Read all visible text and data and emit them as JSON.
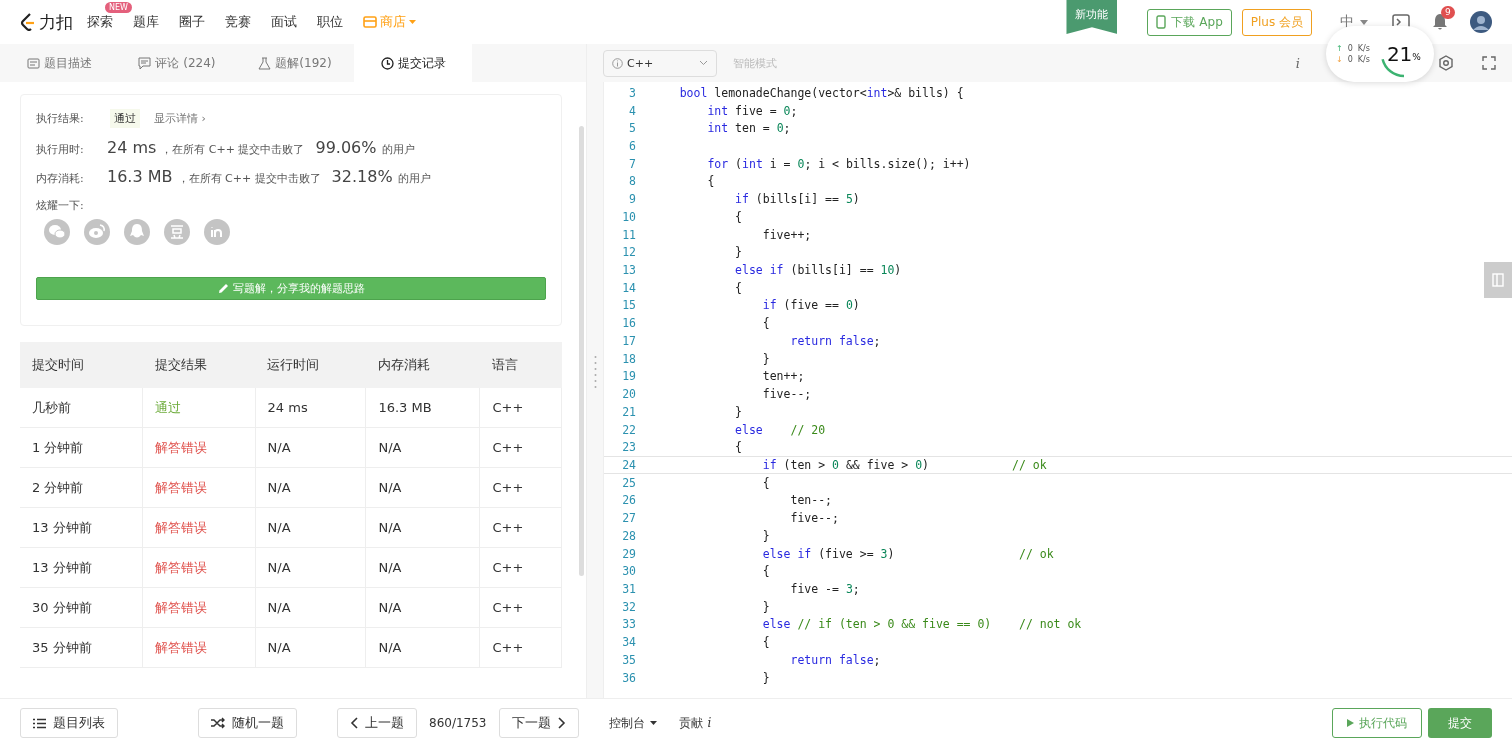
{
  "nav": {
    "brand": "力扣",
    "items": [
      {
        "label": "探索",
        "badge": "NEW",
        "kind": "plain"
      },
      {
        "label": "题库",
        "kind": "plain"
      },
      {
        "label": "圈子",
        "kind": "plain"
      },
      {
        "label": "竞赛",
        "kind": "plain"
      },
      {
        "label": "面试",
        "kind": "plain"
      },
      {
        "label": "职位",
        "kind": "plain"
      },
      {
        "label": "商店",
        "kind": "store"
      }
    ],
    "new_feature": "新功能",
    "download": "下载 App",
    "plus": "Plus 会员",
    "lang": "中",
    "notifications": "9"
  },
  "monitor": {
    "up_arrow": "↑",
    "up": "0",
    "up_unit": "K/s",
    "down_arrow": "↓",
    "down": "0",
    "down_unit": "K/s",
    "percent": "21",
    "percent_sign": "%",
    "level": 0.21
  },
  "tabs": [
    {
      "label": "题目描述",
      "selected": false
    },
    {
      "label": "评论 (224)",
      "selected": false
    },
    {
      "label": "题解(192)",
      "selected": false
    },
    {
      "label": "提交记录",
      "selected": true
    }
  ],
  "result": {
    "label": "执行结果:",
    "status": "通过",
    "details": "显示详情 ›",
    "stats": [
      {
        "label": "执行用时:",
        "value": "24 ms",
        "text": "，在所有 C++ 提交中击败了",
        "percent": "99.06%",
        "suffix": "的用户"
      },
      {
        "label": "内存消耗:",
        "value": "16.3 MB",
        "text": "，在所有 C++ 提交中击败了",
        "percent": "32.18%",
        "suffix": "的用户"
      }
    ],
    "share_label": "炫耀一下:",
    "share": [
      {
        "kind": "wechat"
      },
      {
        "kind": "weibo"
      },
      {
        "kind": "qq"
      },
      {
        "kind": "douban"
      },
      {
        "kind": "linkedin"
      }
    ],
    "write_button": "写题解，分享我的解题思路"
  },
  "table": {
    "columns": [
      "提交时间",
      "提交结果",
      "运行时间",
      "内存消耗",
      "语言"
    ],
    "rows": [
      {
        "time": "几秒前",
        "result": "通过",
        "kind": "pass",
        "runtime": "24 ms",
        "memory": "16.3 MB",
        "lang": "C++"
      },
      {
        "time": "1 分钟前",
        "result": "解答错误",
        "kind": "fail",
        "runtime": "N/A",
        "memory": "N/A",
        "lang": "C++"
      },
      {
        "time": "2 分钟前",
        "result": "解答错误",
        "kind": "fail",
        "runtime": "N/A",
        "memory": "N/A",
        "lang": "C++"
      },
      {
        "time": "13 分钟前",
        "result": "解答错误",
        "kind": "fail",
        "runtime": "N/A",
        "memory": "N/A",
        "lang": "C++"
      },
      {
        "time": "13 分钟前",
        "result": "解答错误",
        "kind": "fail",
        "runtime": "N/A",
        "memory": "N/A",
        "lang": "C++"
      },
      {
        "time": "30 分钟前",
        "result": "解答错误",
        "kind": "fail",
        "runtime": "N/A",
        "memory": "N/A",
        "lang": "C++"
      },
      {
        "time": "35 分钟前",
        "result": "解答错误",
        "kind": "fail",
        "runtime": "N/A",
        "memory": "N/A",
        "lang": "C++"
      }
    ]
  },
  "editor": {
    "language": "C++",
    "smart_mode": "智能模式",
    "info": "i",
    "lines": [
      {
        "n": "3",
        "current": false,
        "parts": [
          {
            "kind": "kw",
            "t": "    bool"
          },
          {
            "kind": "plain",
            "t": " lemonadeChange(vector<"
          },
          {
            "kind": "kw",
            "t": "int"
          },
          {
            "kind": "plain",
            "t": ">& bills) {"
          }
        ]
      },
      {
        "n": "4",
        "current": false,
        "parts": [
          {
            "kind": "kw",
            "t": "        int"
          },
          {
            "kind": "plain",
            "t": " five = "
          },
          {
            "kind": "num",
            "t": "0"
          },
          {
            "kind": "plain",
            "t": ";"
          }
        ]
      },
      {
        "n": "5",
        "current": false,
        "parts": [
          {
            "kind": "kw",
            "t": "        int"
          },
          {
            "kind": "plain",
            "t": " ten = "
          },
          {
            "kind": "num",
            "t": "0"
          },
          {
            "kind": "plain",
            "t": ";"
          }
        ]
      },
      {
        "n": "6",
        "current": false
      },
      {
        "n": "7",
        "current": false,
        "parts": [
          {
            "kind": "kw",
            "t": "        for"
          },
          {
            "kind": "plain",
            "t": " ("
          },
          {
            "kind": "kw",
            "t": "int"
          },
          {
            "kind": "plain",
            "t": " i = "
          },
          {
            "kind": "num",
            "t": "0"
          },
          {
            "kind": "plain",
            "t": "; i < bills.size(); i++)"
          }
        ]
      },
      {
        "n": "8",
        "current": false,
        "parts": [
          {
            "kind": "plain",
            "t": "        {"
          }
        ]
      },
      {
        "n": "9",
        "current": false,
        "parts": [
          {
            "kind": "kw",
            "t": "            if"
          },
          {
            "kind": "plain",
            "t": " (bills[i] == "
          },
          {
            "kind": "num",
            "t": "5"
          },
          {
            "kind": "plain",
            "t": ")"
          }
        ]
      },
      {
        "n": "10",
        "current": false,
        "parts": [
          {
            "kind": "plain",
            "t": "            {"
          }
        ]
      },
      {
        "n": "11",
        "current": false,
        "parts": [
          {
            "kind": "plain",
            "t": "                five++;"
          }
        ]
      },
      {
        "n": "12",
        "current": false,
        "parts": [
          {
            "kind": "plain",
            "t": "            }"
          }
        ]
      },
      {
        "n": "13",
        "current": false,
        "parts": [
          {
            "kind": "kw",
            "t": "            else if"
          },
          {
            "kind": "plain",
            "t": " (bills[i] == "
          },
          {
            "kind": "num",
            "t": "10"
          },
          {
            "kind": "plain",
            "t": ")"
          }
        ]
      },
      {
        "n": "14",
        "current": false,
        "parts": [
          {
            "kind": "plain",
            "t": "            {"
          }
        ]
      },
      {
        "n": "15",
        "current": false,
        "parts": [
          {
            "kind": "kw",
            "t": "                if"
          },
          {
            "kind": "plain",
            "t": " (five == "
          },
          {
            "kind": "num",
            "t": "0"
          },
          {
            "kind": "plain",
            "t": ")"
          }
        ]
      },
      {
        "n": "16",
        "current": false,
        "parts": [
          {
            "kind": "plain",
            "t": "                {"
          }
        ]
      },
      {
        "n": "17",
        "current": false,
        "parts": [
          {
            "kind": "kw",
            "t": "                    return false"
          },
          {
            "kind": "plain",
            "t": ";"
          }
        ]
      },
      {
        "n": "18",
        "current": false,
        "parts": [
          {
            "kind": "plain",
            "t": "                }"
          }
        ]
      },
      {
        "n": "19",
        "current": false,
        "parts": [
          {
            "kind": "plain",
            "t": "                ten++;"
          }
        ]
      },
      {
        "n": "20",
        "current": false,
        "parts": [
          {
            "kind": "plain",
            "t": "                five--;"
          }
        ]
      },
      {
        "n": "21",
        "current": false,
        "parts": [
          {
            "kind": "plain",
            "t": "            }"
          }
        ]
      },
      {
        "n": "22",
        "current": false,
        "parts": [
          {
            "kind": "kw",
            "t": "            else"
          },
          {
            "kind": "cm",
            "t": "    // 20"
          }
        ]
      },
      {
        "n": "23",
        "current": false,
        "parts": [
          {
            "kind": "plain",
            "t": "            {"
          }
        ]
      },
      {
        "n": "24",
        "current": true,
        "parts": [
          {
            "kind": "kw",
            "t": "                if"
          },
          {
            "kind": "plain",
            "t": " (ten > "
          },
          {
            "kind": "num",
            "t": "0"
          },
          {
            "kind": "plain",
            "t": " && five > "
          },
          {
            "kind": "num",
            "t": "0"
          },
          {
            "kind": "plain",
            "t": ")            "
          },
          {
            "kind": "cm",
            "t": "// ok"
          }
        ]
      },
      {
        "n": "25",
        "current": false,
        "parts": [
          {
            "kind": "plain",
            "t": "                {"
          }
        ]
      },
      {
        "n": "26",
        "current": false,
        "parts": [
          {
            "kind": "plain",
            "t": "                    ten--;"
          }
        ]
      },
      {
        "n": "27",
        "current": false,
        "parts": [
          {
            "kind": "plain",
            "t": "                    five--;"
          }
        ]
      },
      {
        "n": "28",
        "current": false,
        "parts": [
          {
            "kind": "plain",
            "t": "                }"
          }
        ]
      },
      {
        "n": "29",
        "current": false,
        "parts": [
          {
            "kind": "kw",
            "t": "                else if"
          },
          {
            "kind": "plain",
            "t": " (five >= "
          },
          {
            "kind": "num",
            "t": "3"
          },
          {
            "kind": "plain",
            "t": ")                  "
          },
          {
            "kind": "cm",
            "t": "// ok"
          }
        ]
      },
      {
        "n": "30",
        "current": false,
        "parts": [
          {
            "kind": "plain",
            "t": "                {"
          }
        ]
      },
      {
        "n": "31",
        "current": false,
        "parts": [
          {
            "kind": "plain",
            "t": "                    five -= "
          },
          {
            "kind": "num",
            "t": "3"
          },
          {
            "kind": "plain",
            "t": ";"
          }
        ]
      },
      {
        "n": "32",
        "current": false,
        "parts": [
          {
            "kind": "plain",
            "t": "                }"
          }
        ]
      },
      {
        "n": "33",
        "current": false,
        "parts": [
          {
            "kind": "kw",
            "t": "                else"
          },
          {
            "kind": "cm",
            "t": " // if (ten > 0 && five == 0)    // not ok"
          }
        ]
      },
      {
        "n": "34",
        "current": false,
        "parts": [
          {
            "kind": "plain",
            "t": "                {"
          }
        ]
      },
      {
        "n": "35",
        "current": false,
        "parts": [
          {
            "kind": "kw",
            "t": "                    return false"
          },
          {
            "kind": "plain",
            "t": ";"
          }
        ]
      },
      {
        "n": "36",
        "current": false,
        "parts": [
          {
            "kind": "plain",
            "t": "                }"
          }
        ]
      }
    ]
  },
  "footer": {
    "list": "题目列表",
    "random": "随机一题",
    "prev": "上一题",
    "progress": "860/1753",
    "next": "下一题",
    "console": "控制台",
    "contribute": "贡献",
    "info": "i",
    "run": "执行代码",
    "submit": "提交"
  }
}
